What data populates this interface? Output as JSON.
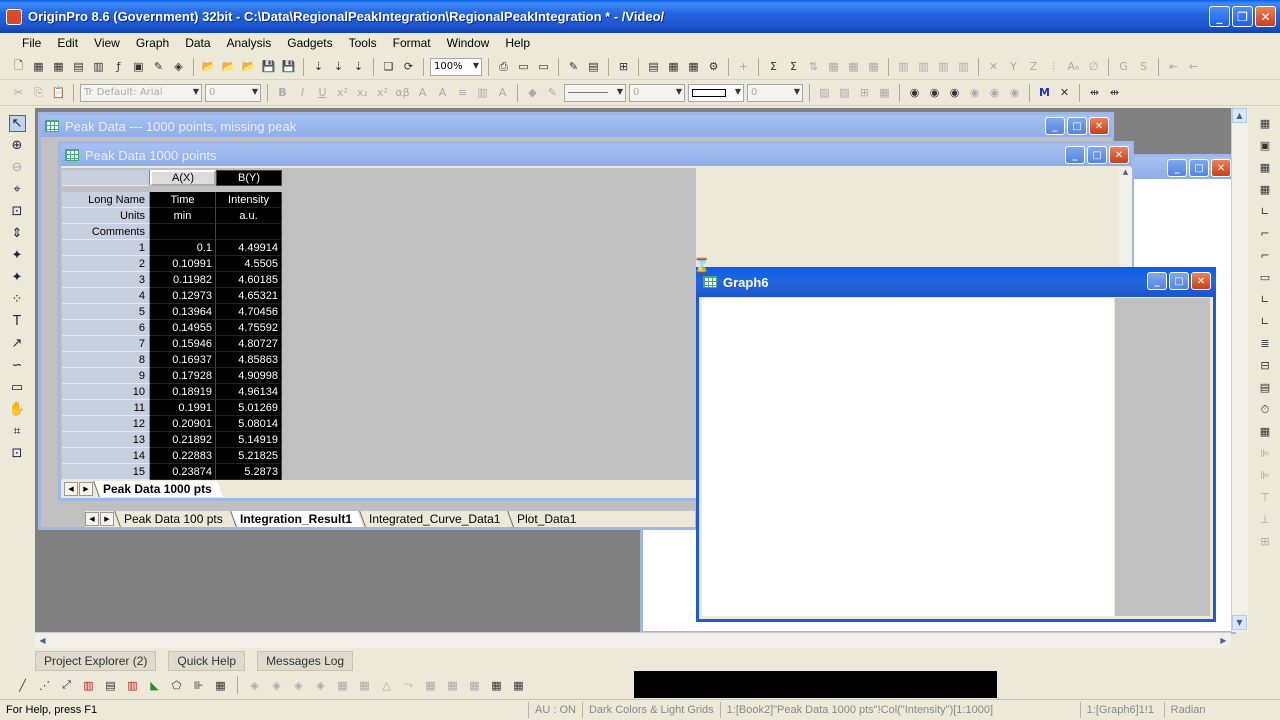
{
  "window": {
    "title": "OriginPro 8.6 (Government) 32bit - C:\\Data\\RegionalPeakIntegration\\RegionalPeakIntegration * - /Video/"
  },
  "menu": [
    "File",
    "Edit",
    "View",
    "Graph",
    "Data",
    "Analysis",
    "Gadgets",
    "Tools",
    "Format",
    "Window",
    "Help"
  ],
  "toolbar": {
    "zoom": "100%",
    "font": "Default: Arial",
    "font_size": "0",
    "line_width": "0",
    "border_width": "0"
  },
  "windows": {
    "back_title": "Peak Data --- 1000 points, missing peak",
    "sheet_title": "Peak Data 1000 points",
    "graph_title": "Graph6"
  },
  "worksheet": {
    "columns": [
      "A(X)",
      "B(Y)"
    ],
    "label_rows": [
      {
        "label": "Long Name",
        "a": "Time",
        "b": "Intensity"
      },
      {
        "label": "Units",
        "a": "min",
        "b": "a.u."
      },
      {
        "label": "Comments",
        "a": "",
        "b": ""
      }
    ],
    "rows": [
      [
        "1",
        "0.1",
        "4.49914"
      ],
      [
        "2",
        "0.10991",
        "4.5505"
      ],
      [
        "3",
        "0.11982",
        "4.60185"
      ],
      [
        "4",
        "0.12973",
        "4.65321"
      ],
      [
        "5",
        "0.13964",
        "4.70456"
      ],
      [
        "6",
        "0.14955",
        "4.75592"
      ],
      [
        "7",
        "0.15946",
        "4.80727"
      ],
      [
        "8",
        "0.16937",
        "4.85863"
      ],
      [
        "9",
        "0.17928",
        "4.90998"
      ],
      [
        "10",
        "0.18919",
        "4.96134"
      ],
      [
        "11",
        "0.1991",
        "5.01269"
      ],
      [
        "12",
        "0.20901",
        "5.08014"
      ],
      [
        "13",
        "0.21892",
        "5.14919"
      ],
      [
        "14",
        "0.22883",
        "5.21825"
      ],
      [
        "15",
        "0.23874",
        "5.2873"
      ]
    ],
    "sheet_tab": "Peak Data 1000 pts"
  },
  "back_sheet_tabs": [
    "Peak Data 100 pts",
    "Integration_Result1",
    "Integrated_Curve_Data1",
    "Plot_Data1"
  ],
  "back_active_tab": "Integration_Result1",
  "panels": [
    "Project Explorer (2)",
    "Quick Help",
    "Messages Log"
  ],
  "status": {
    "help": "For Help, press F1",
    "au": "AU : ON",
    "theme": "Dark Colors & Light Grids",
    "col": "1:[Book2]\"Peak Data 1000 pts\"!Col(\"Intensity\")[1:1000]",
    "graph": "1:[Graph6]1!1",
    "unit": "Radian"
  }
}
